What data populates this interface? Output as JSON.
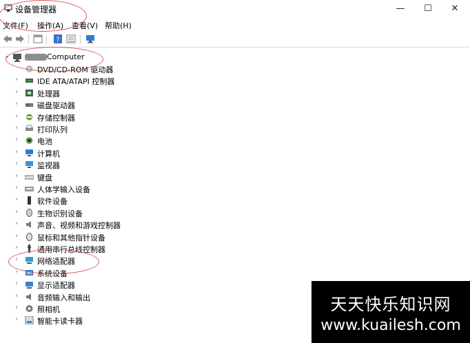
{
  "window": {
    "title": "设备管理器",
    "minimize": "—",
    "maximize": "☐",
    "close": "✕"
  },
  "menu": [
    "文件(F)",
    "操作(A)",
    "查看(V)",
    "帮助(H)"
  ],
  "toolbar_icons": [
    "back-icon",
    "forward-icon",
    "properties-icon",
    "help-icon",
    "view-icon",
    "monitor-icon"
  ],
  "tree": {
    "root_label": "Computer",
    "items": [
      {
        "label": "DVD/CD-ROM 驱动器",
        "icon": "dvd-icon",
        "expand": ""
      },
      {
        "label": "IDE ATA/ATAPI 控制器",
        "icon": "ide-icon",
        "expand": "›"
      },
      {
        "label": "处理器",
        "icon": "cpu-icon",
        "expand": "›"
      },
      {
        "label": "磁盘驱动器",
        "icon": "disk-icon",
        "expand": "›"
      },
      {
        "label": "存储控制器",
        "icon": "storage-icon",
        "expand": "›"
      },
      {
        "label": "打印队列",
        "icon": "printer-icon",
        "expand": "›"
      },
      {
        "label": "电池",
        "icon": "battery-icon",
        "expand": "›"
      },
      {
        "label": "计算机",
        "icon": "computer-icon",
        "expand": "›"
      },
      {
        "label": "监视器",
        "icon": "monitor-icon",
        "expand": "›"
      },
      {
        "label": "键盘",
        "icon": "keyboard-icon",
        "expand": "›"
      },
      {
        "label": "人体学输入设备",
        "icon": "hid-icon",
        "expand": "›"
      },
      {
        "label": "软件设备",
        "icon": "software-device-icon",
        "expand": "›"
      },
      {
        "label": "生物识别设备",
        "icon": "biometric-icon",
        "expand": "›"
      },
      {
        "label": "声音、视频和游戏控制器",
        "icon": "sound-icon",
        "expand": "›"
      },
      {
        "label": "鼠标和其他指针设备",
        "icon": "mouse-icon",
        "expand": "›"
      },
      {
        "label": "通用串行总线控制器",
        "icon": "usb-icon",
        "expand": "›"
      },
      {
        "label": "网络适配器",
        "icon": "network-icon",
        "expand": "›"
      },
      {
        "label": "系统设备",
        "icon": "system-icon",
        "expand": "›"
      },
      {
        "label": "显示适配器",
        "icon": "display-icon",
        "expand": "›"
      },
      {
        "label": "音频输入和输出",
        "icon": "audio-icon",
        "expand": "›"
      },
      {
        "label": "照相机",
        "icon": "camera-icon",
        "expand": "›"
      },
      {
        "label": "智能卡读卡器",
        "icon": "smartcard-icon",
        "expand": "›"
      }
    ]
  },
  "watermark": {
    "line1": "天天快乐知识网",
    "line2": "www.kuailesh.com"
  },
  "colors": {
    "annotation": "#d9534f",
    "accent": "#2a7fd4"
  }
}
